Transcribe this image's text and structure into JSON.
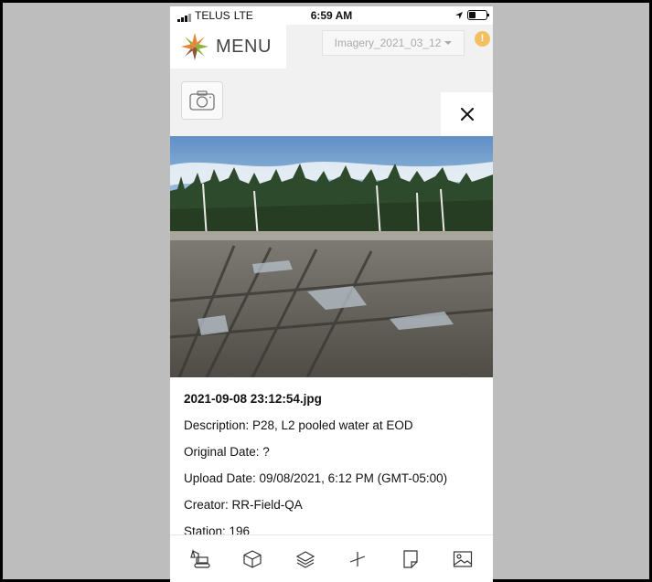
{
  "status_bar": {
    "carrier": "TELUS",
    "network": "LTE",
    "time": "6:59 AM"
  },
  "header": {
    "menu_label": "MENU",
    "imagery_select_value": "Imagery_2021_03_12",
    "alert_badge": "!"
  },
  "photo_details": {
    "filename": "2021-09-08 23:12:54.jpg",
    "description": "Description: P28, L2 pooled water at EOD",
    "original_date": "Original Date: ?",
    "upload_date": "Upload Date: 09/08/2021, 6:12 PM (GMT-05:00)",
    "creator": "Creator: RR-Field-QA",
    "station": "Station: 196"
  },
  "tabs": [
    "excavator-icon",
    "box-3d-icon",
    "layers-icon",
    "measure-icon",
    "note-icon",
    "image-icon"
  ],
  "colors": {
    "alert": "#f2c062",
    "logo_orange": "#e8833a",
    "logo_green": "#8bb33a",
    "logo_brown": "#8a5a3b"
  }
}
